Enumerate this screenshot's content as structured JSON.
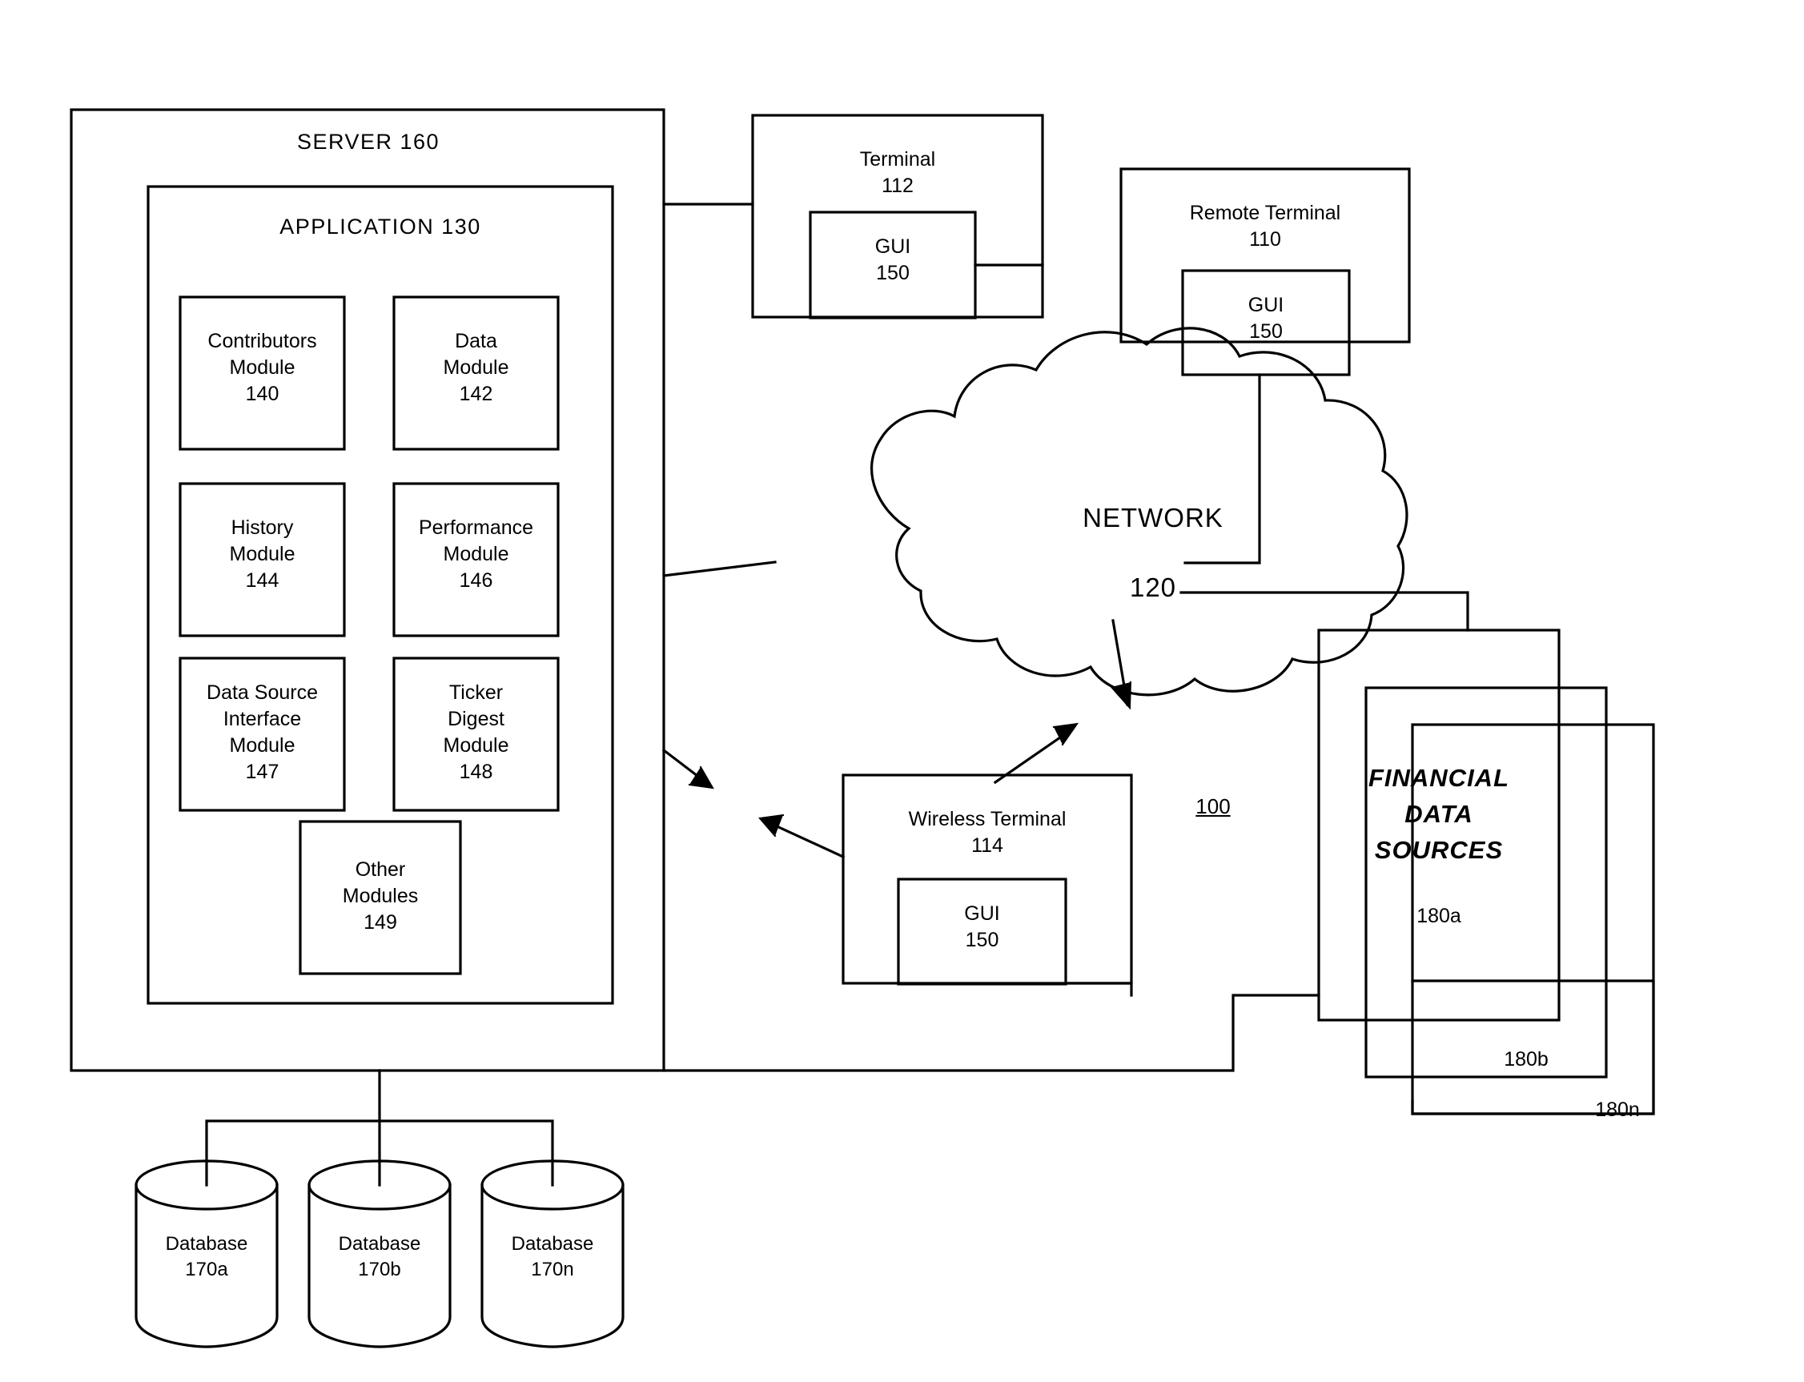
{
  "figure": {
    "reference_numeral": "100"
  },
  "server": {
    "title": "SERVER   160",
    "application": {
      "title": "APPLICATION    130",
      "modules": [
        {
          "id": "contributors",
          "label": "Contributors\nModule\n140"
        },
        {
          "id": "data",
          "label": "Data\nModule\n142"
        },
        {
          "id": "history",
          "label": "History\nModule\n144"
        },
        {
          "id": "performance",
          "label": "Performance\nModule\n146"
        },
        {
          "id": "data-source-interface",
          "label": "Data Source\nInterface\nModule\n147"
        },
        {
          "id": "ticker-digest",
          "label": "Ticker\nDigest\nModule\n148"
        },
        {
          "id": "other",
          "label": "Other\nModules\n149"
        }
      ]
    }
  },
  "terminals": {
    "terminal": {
      "label": "Terminal\n112",
      "gui": "GUI\n150"
    },
    "remote_terminal": {
      "label": "Remote Terminal\n110",
      "gui": "GUI\n150"
    },
    "wireless_terminal": {
      "label": "Wireless Terminal\n114",
      "gui": "GUI\n150"
    }
  },
  "network": {
    "label": "NETWORK",
    "number": "120"
  },
  "financial_data_sources": {
    "label": "FINANCIAL\nDATA\nSOURCES",
    "front_number": "180a",
    "middle_number": "180b",
    "back_number": "180n"
  },
  "databases": [
    {
      "label": "Database\n170a"
    },
    {
      "label": "Database\n170b"
    },
    {
      "label": "Database\n170n"
    }
  ]
}
